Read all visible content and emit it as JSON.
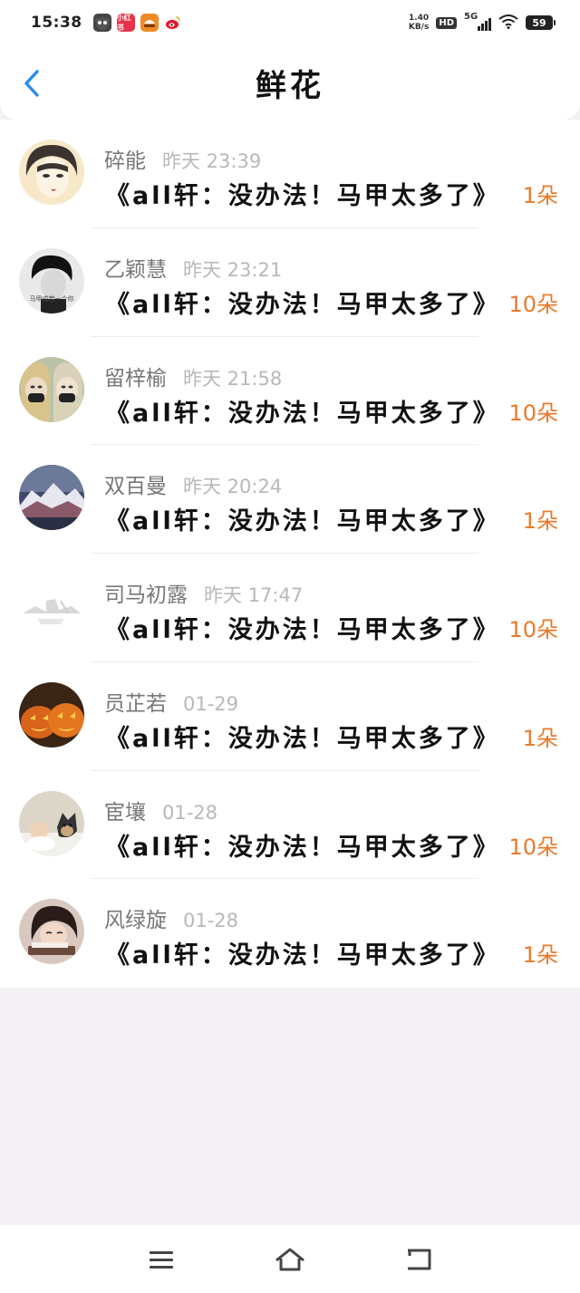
{
  "status_bar": {
    "time": "15:38",
    "speed_top": "1.40",
    "speed_bottom": "KB/s",
    "hd": "HD",
    "network": "5G",
    "battery": "59",
    "apps": [
      {
        "icon": "monkey-app-icon",
        "color": "#444444",
        "label": ""
      },
      {
        "icon": "xiaohongshu-app-icon",
        "color": "#e8344a",
        "label": "小红书"
      },
      {
        "icon": "food-app-icon",
        "color": "#f08a24",
        "label": ""
      },
      {
        "icon": "weibo-app-icon",
        "color": "#f5b81c",
        "label": ""
      }
    ]
  },
  "header": {
    "title": "鲜花",
    "back_icon": "chevron-left-icon",
    "accent": "#2a8ee8"
  },
  "colors": {
    "count": "#ea7a2a",
    "name": "#777777",
    "time": "#b8b8b8"
  },
  "items": [
    {
      "name": "碎能",
      "time": "昨天 23:39",
      "title": "《all轩：没办法！马甲太多了》",
      "count": "1朵",
      "avatar": "cartoon-girl-avatar"
    },
    {
      "name": "乙颖慧",
      "time": "昨天 23:21",
      "title": "《all轩：没办法！马甲太多了》",
      "count": "10朵",
      "avatar": "bw-man-avatar",
      "avatar_text": "马甲成若一个你"
    },
    {
      "name": "留梓榆",
      "time": "昨天 21:58",
      "title": "《all轩：没办法！马甲太多了》",
      "count": "10朵",
      "avatar": "two-girls-masks-avatar"
    },
    {
      "name": "双百曼",
      "time": "昨天 20:24",
      "title": "《all轩：没办法！马甲太多了》",
      "count": "1朵",
      "avatar": "snowy-mountain-avatar"
    },
    {
      "name": "司马初露",
      "time": "昨天 17:47",
      "title": "《all轩：没办法！马甲太多了》",
      "count": "10朵",
      "avatar": "faded-landscape-avatar"
    },
    {
      "name": "员芷若",
      "time": "01-29",
      "title": "《all轩：没办法！马甲太多了》",
      "count": "1朵",
      "avatar": "pumpkins-avatar"
    },
    {
      "name": "宦壤",
      "time": "01-28",
      "title": "《all轩：没办法！马甲太多了》",
      "count": "10朵",
      "avatar": "baby-and-dog-avatar"
    },
    {
      "name": "风绿旋",
      "time": "01-28",
      "title": "《all轩：没办法！马甲太多了》",
      "count": "1朵",
      "avatar": "reading-girl-avatar"
    }
  ],
  "nav": {
    "menu_icon": "menu-icon",
    "home_icon": "home-icon",
    "back_icon": "back-icon"
  }
}
